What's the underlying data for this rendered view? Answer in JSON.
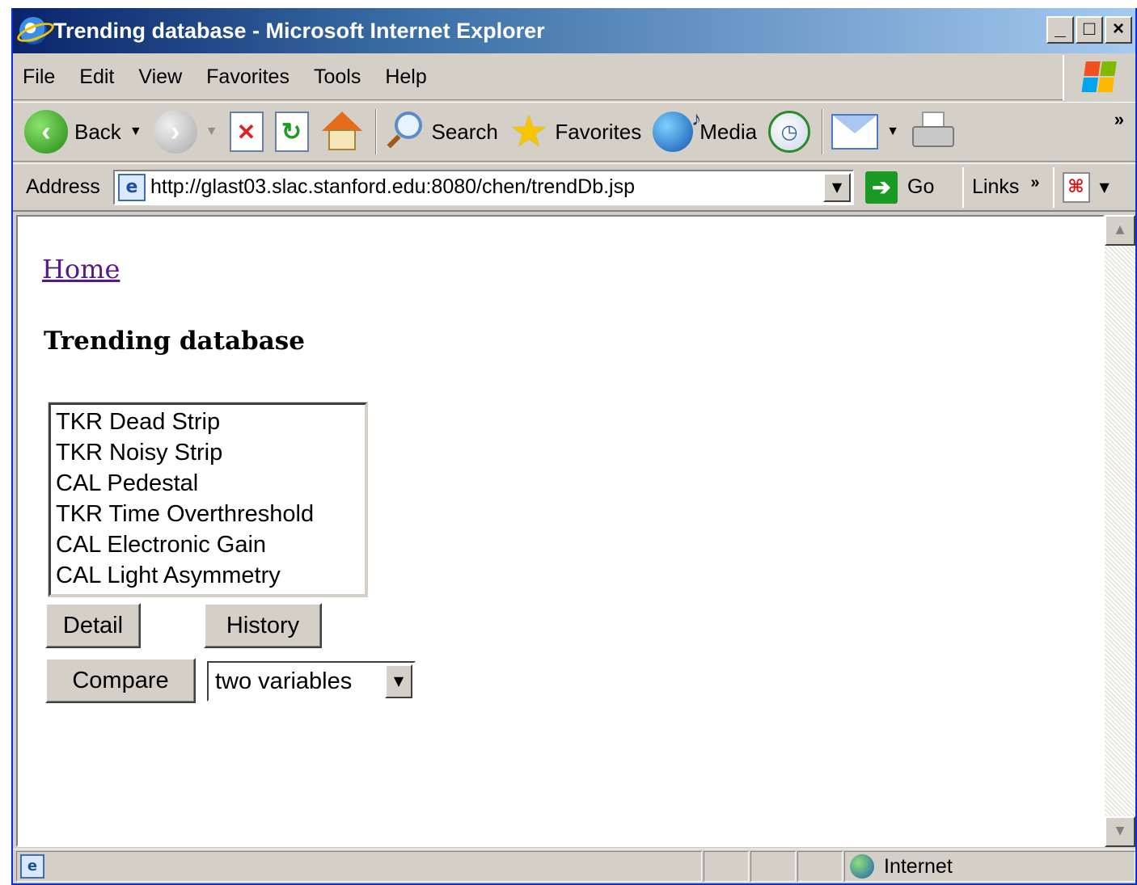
{
  "window": {
    "title": "Trending database - Microsoft Internet Explorer",
    "buttons": {
      "minimize": "_",
      "maximize": "□",
      "close": "×"
    }
  },
  "menubar": {
    "items": [
      "File",
      "Edit",
      "View",
      "Favorites",
      "Tools",
      "Help"
    ]
  },
  "toolbar": {
    "back_label": "Back",
    "search_label": "Search",
    "favorites_label": "Favorites",
    "media_label": "Media",
    "more": "»"
  },
  "addressbar": {
    "label": "Address",
    "url": "http://glast03.slac.stanford.edu:8080/chen/trendDb.jsp",
    "go_label": "Go",
    "links_label": "Links",
    "links_more": "»"
  },
  "page": {
    "home_link": "Home",
    "title": "Trending database",
    "listbox_options": [
      "TKR Dead Strip",
      "TKR Noisy Strip",
      "CAL Pedestal",
      "TKR Time Overthreshold",
      "CAL Electronic Gain",
      "CAL Light Asymmetry"
    ],
    "detail_button": "Detail",
    "history_button": "History",
    "compare_button": "Compare",
    "compare_select_value": "two variables"
  },
  "statusbar": {
    "zone_label": "Internet"
  },
  "colors": {
    "title_gradient_start": "#0a246a",
    "chrome": "#d4d0c8",
    "visited_link": "#551a8b"
  }
}
